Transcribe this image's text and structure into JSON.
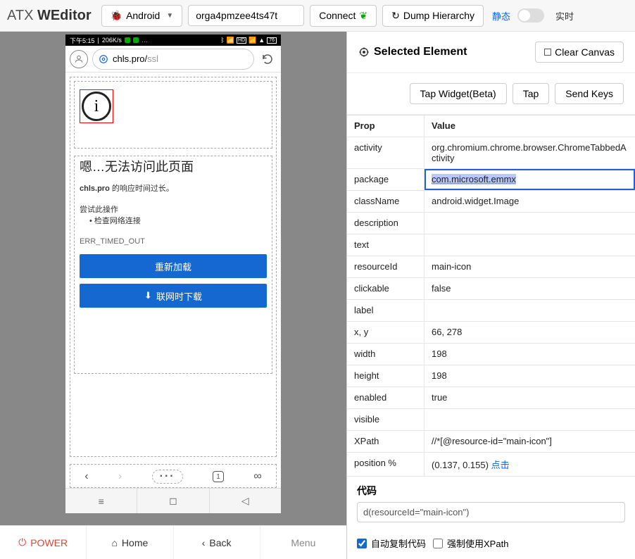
{
  "header": {
    "app_title_pre": "ATX ",
    "app_title_bold": "WEditor",
    "platform": "Android",
    "serial": "orga4pmzee4ts47t",
    "connect": "Connect",
    "dump": "Dump Hierarchy",
    "mode_static": "静态",
    "mode_live": "实时"
  },
  "phone": {
    "time": "下午5:15",
    "netspeed": "206K/s",
    "battery": "76",
    "url_prefix": "chls.pro/",
    "url_suffix": "ssl",
    "err_title": "嗯…无法访问此页面",
    "err_sub_host": "chls.pro",
    "err_sub_tail": " 的响应时间过长。",
    "err_try": "尝试此操作",
    "err_bullet": "• 检查网络连接",
    "err_code": "ERR_TIMED_OUT",
    "btn_reload": "重新加载",
    "btn_download": "联网时下载",
    "nav_back": "≡",
    "nav_home": "◻",
    "nav_recent": "◁"
  },
  "footer": {
    "power": "POWER",
    "home": "Home",
    "back": "Back",
    "menu": "Menu"
  },
  "right": {
    "title": "Selected Element",
    "clear": "Clear Canvas",
    "tap_widget": "Tap Widget(Beta)",
    "tap": "Tap",
    "send_keys": "Send Keys",
    "head_prop": "Prop",
    "head_value": "Value",
    "props": {
      "activity": {
        "k": "activity",
        "v": "org.chromium.chrome.browser.ChromeTabbedActivity"
      },
      "package": {
        "k": "package",
        "v": "com.microsoft.emmx"
      },
      "className": {
        "k": "className",
        "v": "android.widget.Image"
      },
      "description": {
        "k": "description",
        "v": ""
      },
      "text": {
        "k": "text",
        "v": ""
      },
      "resourceId": {
        "k": "resourceId",
        "v": "main-icon"
      },
      "clickable": {
        "k": "clickable",
        "v": "false"
      },
      "label": {
        "k": "label",
        "v": ""
      },
      "xy": {
        "k": "x, y",
        "v": "66, 278"
      },
      "width": {
        "k": "width",
        "v": "198"
      },
      "height": {
        "k": "height",
        "v": "198"
      },
      "enabled": {
        "k": "enabled",
        "v": "true"
      },
      "visible": {
        "k": "visible",
        "v": ""
      },
      "xpath": {
        "k": "XPath",
        "v": "//*[@resource-id=\"main-icon\"]"
      },
      "position": {
        "k": "position %",
        "v": "(0.137, 0.155) ",
        "link": "点击"
      }
    },
    "code_label": "代码",
    "code_value": "d(resourceId=\"main-icon\")",
    "auto_copy": "自动复制代码",
    "force_xpath": "强制使用XPath"
  }
}
